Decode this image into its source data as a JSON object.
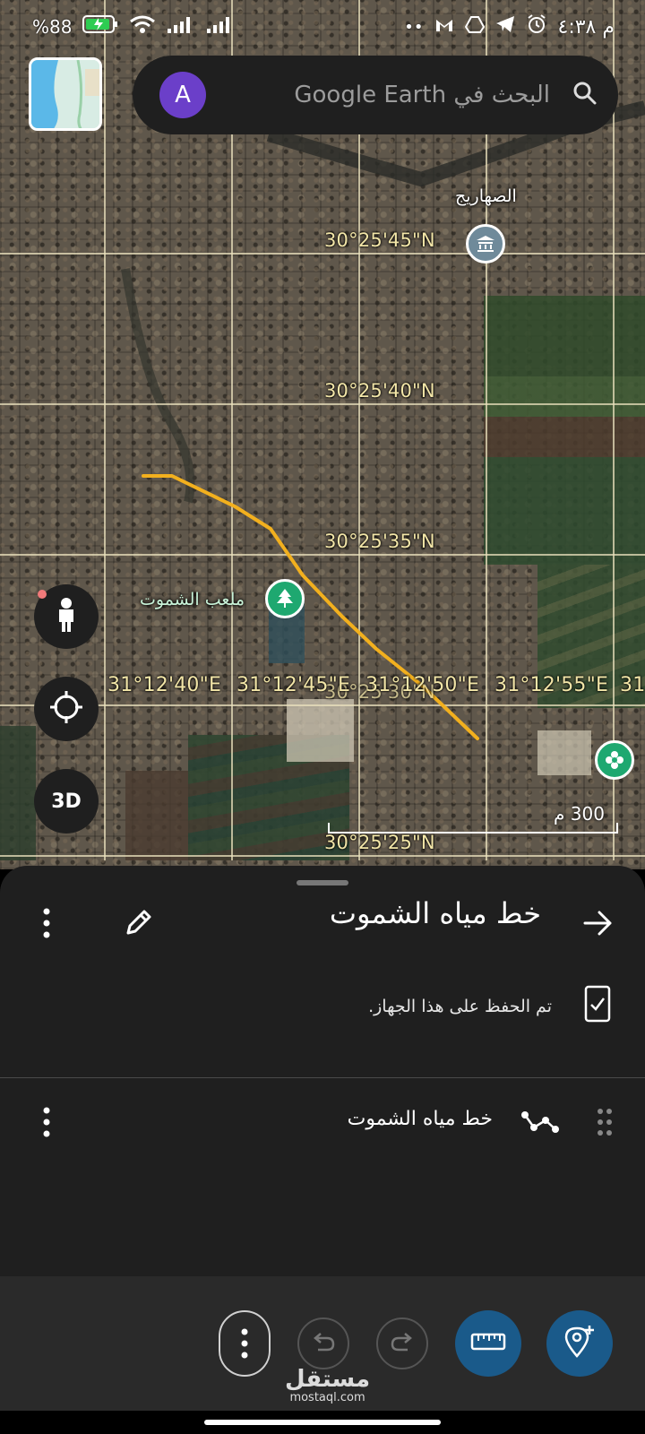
{
  "status_bar": {
    "time": "٤:٣٨",
    "time_suffix": "م",
    "battery": "88",
    "battery_symbol": "%"
  },
  "search": {
    "avatar_letter": "A",
    "placeholder": "البحث في Google Earth"
  },
  "map": {
    "latitudes": [
      "30°25'45\"N",
      "30°25'40\"N",
      "30°25'35\"N",
      "30°25'30\"N",
      "30°25'25\"N"
    ],
    "longitudes": [
      "31°12'40\"E",
      "31°12'45\"E",
      "31°12'50\"E",
      "31°12'55\"E",
      "31°"
    ],
    "places": {
      "top": "الصهاريج",
      "stadium": "ملعب الشموت"
    },
    "path_color": "#f2b01e",
    "scale_label": "300 م"
  },
  "controls": {
    "threed_label": "3D"
  },
  "sheet": {
    "title": "خط مياه الشموت",
    "saved_message": "تم الحفظ على هذا الجهاز.",
    "feature_name": "خط مياه الشموت"
  },
  "watermark": {
    "main": "مستقل",
    "sub": "mostaql.com"
  },
  "colors": {
    "accent_blue": "#1a5a8a",
    "avatar_purple": "#6b3fc9",
    "pin_green": "#1ea870",
    "pin_gray": "#6f8a9a",
    "sheet_bg": "#1f1f1f"
  }
}
